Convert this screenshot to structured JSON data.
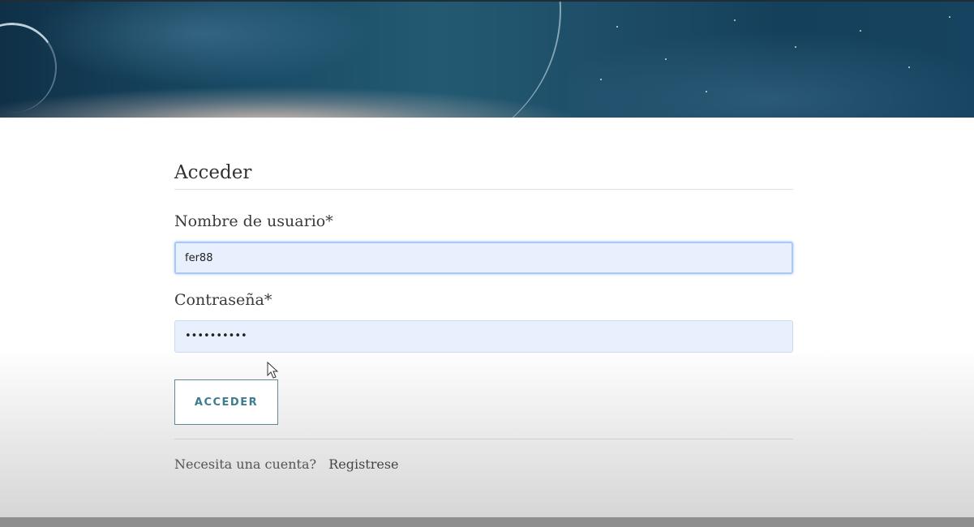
{
  "login": {
    "title": "Acceder",
    "username_label": "Nombre de usuario*",
    "username_value": "fer88",
    "password_label": "Contraseña*",
    "password_value": "••••••••••",
    "submit_label": "ACCEDER"
  },
  "footer": {
    "prompt": "Necesita una cuenta?",
    "register_link": "Registrese"
  },
  "colors": {
    "accent": "#3d7c8e",
    "input_bg": "#e8f0fe",
    "hero_dark": "#15405b"
  },
  "icons": {
    "cursor": "mouse-pointer-icon"
  }
}
